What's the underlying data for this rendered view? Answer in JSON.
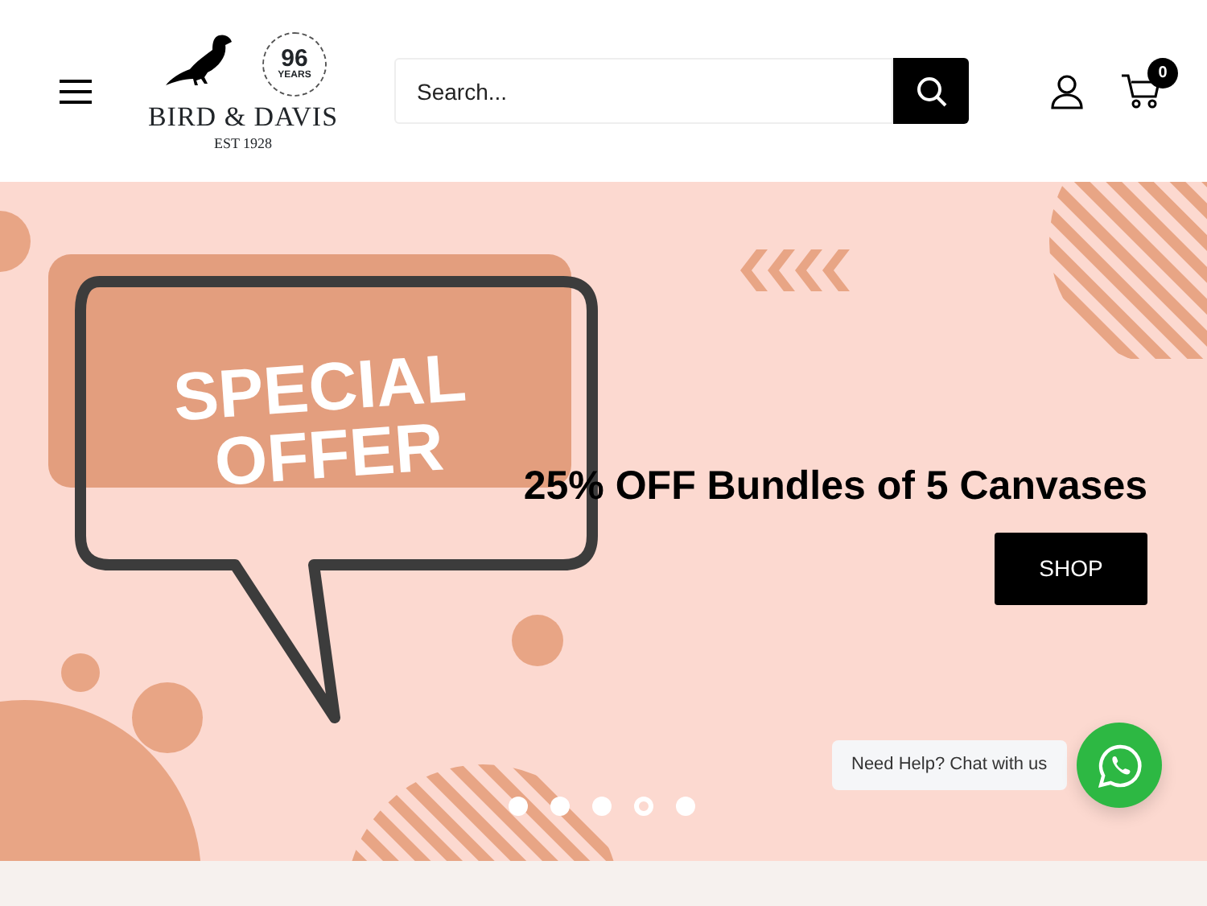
{
  "header": {
    "logo": {
      "years": "96",
      "years_label": "YEARS",
      "name": "BIRD & DAVIS",
      "established": "EST 1928"
    },
    "search": {
      "placeholder": "Search..."
    },
    "cart": {
      "count": "0"
    }
  },
  "banner": {
    "graphic_text": [
      "SPECIAL",
      "OFFER"
    ],
    "headline": "25% OFF Bundles of 5 Canvases",
    "button": "SHOP",
    "slides": [
      {
        "selected": false
      },
      {
        "selected": false
      },
      {
        "selected": false
      },
      {
        "selected": true
      },
      {
        "selected": false
      }
    ]
  },
  "chat": {
    "label": "Need Help? Chat with us"
  }
}
